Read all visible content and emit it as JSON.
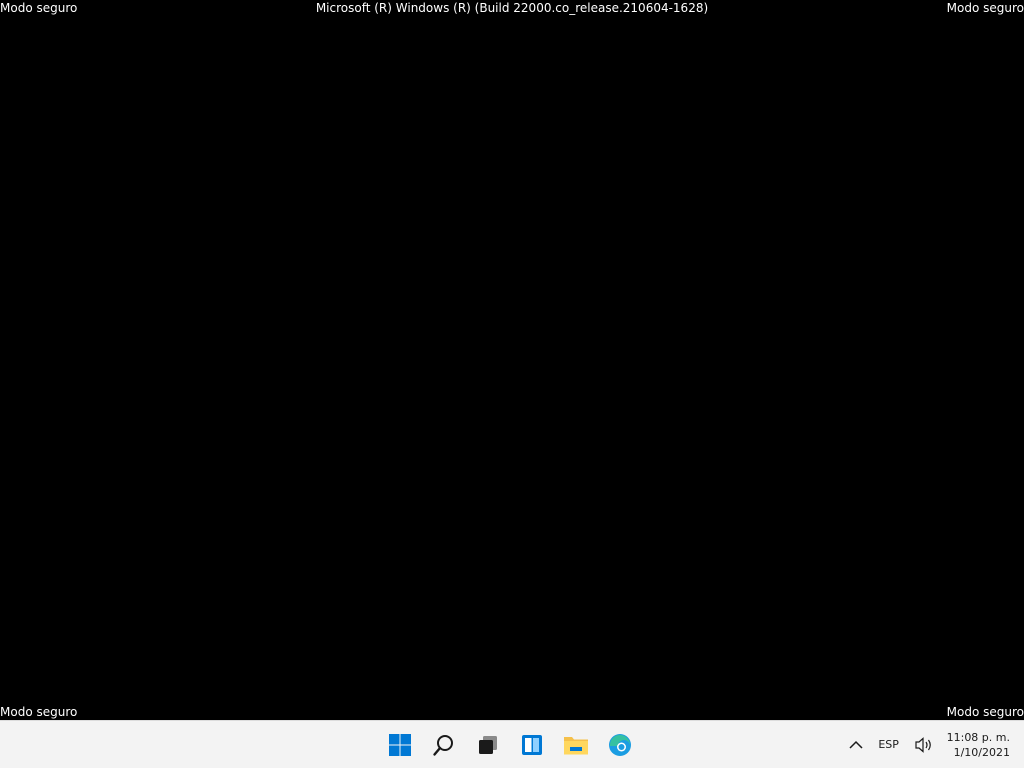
{
  "desktop": {
    "watermark_top_left": "Modo seguro",
    "watermark_top_right": "Modo seguro",
    "watermark_bottom_left": "Modo seguro",
    "watermark_bottom_right": "Modo seguro",
    "build_info": "Microsoft (R) Windows (R) (Build 22000.co_release.210604-1628)"
  },
  "taskbar": {
    "pinned": [
      {
        "name": "start",
        "icon": "windows-logo-icon"
      },
      {
        "name": "search",
        "icon": "search-icon"
      },
      {
        "name": "task-view",
        "icon": "task-view-icon"
      },
      {
        "name": "widgets",
        "icon": "widgets-icon"
      },
      {
        "name": "file-explorer",
        "icon": "folder-icon"
      },
      {
        "name": "edge",
        "icon": "edge-icon"
      }
    ],
    "tray": {
      "chevron_icon": "chevron-up-icon",
      "language": "ESP",
      "volume_icon": "speaker-icon",
      "time": "11:08 p. m.",
      "date": "1/10/2021"
    }
  },
  "colors": {
    "taskbar_bg": "#f3f3f3",
    "desktop_bg": "#000000",
    "windows_blue": "#0078d4",
    "folder_yellow": "#f5c04a"
  }
}
